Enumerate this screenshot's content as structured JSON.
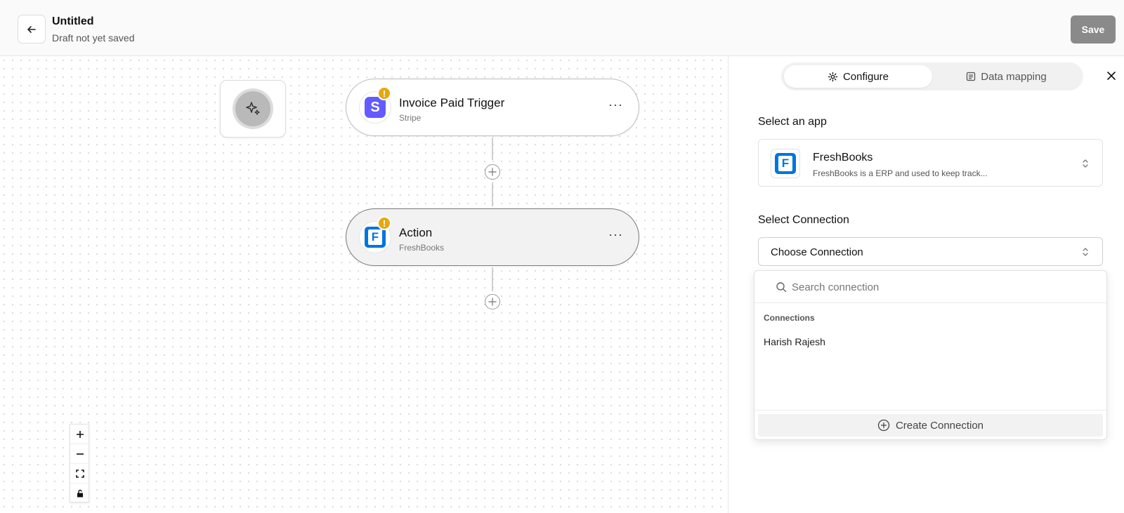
{
  "header": {
    "title": "Untitled",
    "status": "Draft not yet saved",
    "save_label": "Save"
  },
  "canvas": {
    "nodes": [
      {
        "title": "Invoice Paid Trigger",
        "subtitle": "Stripe",
        "icon": "stripe-logo",
        "logo_letter": "S",
        "warning": "!"
      },
      {
        "title": "Action",
        "subtitle": "FreshBooks",
        "icon": "freshbooks-logo",
        "logo_letter": "F",
        "warning": "!"
      }
    ],
    "node_menu": "···"
  },
  "panel": {
    "tabs": [
      {
        "label": "Configure",
        "icon": "gear-icon",
        "active": true
      },
      {
        "label": "Data mapping",
        "icon": "document-icon",
        "active": false
      }
    ],
    "select_app_label": "Select an app",
    "app": {
      "name": "FreshBooks",
      "description": "FreshBooks is a ERP and used to keep track...",
      "logo_letter": "F"
    },
    "select_connection_label": "Select Connection",
    "connection_value": "Choose Connection",
    "dropdown": {
      "search_placeholder": "Search connection",
      "group_label": "Connections",
      "items": [
        "Harish Rajesh"
      ],
      "create_label": "Create Connection"
    }
  },
  "colors": {
    "stripe": "#635bff",
    "freshbooks": "#0075dd",
    "warning": "#e5a80d",
    "save_disabled": "#8a8a8a"
  }
}
